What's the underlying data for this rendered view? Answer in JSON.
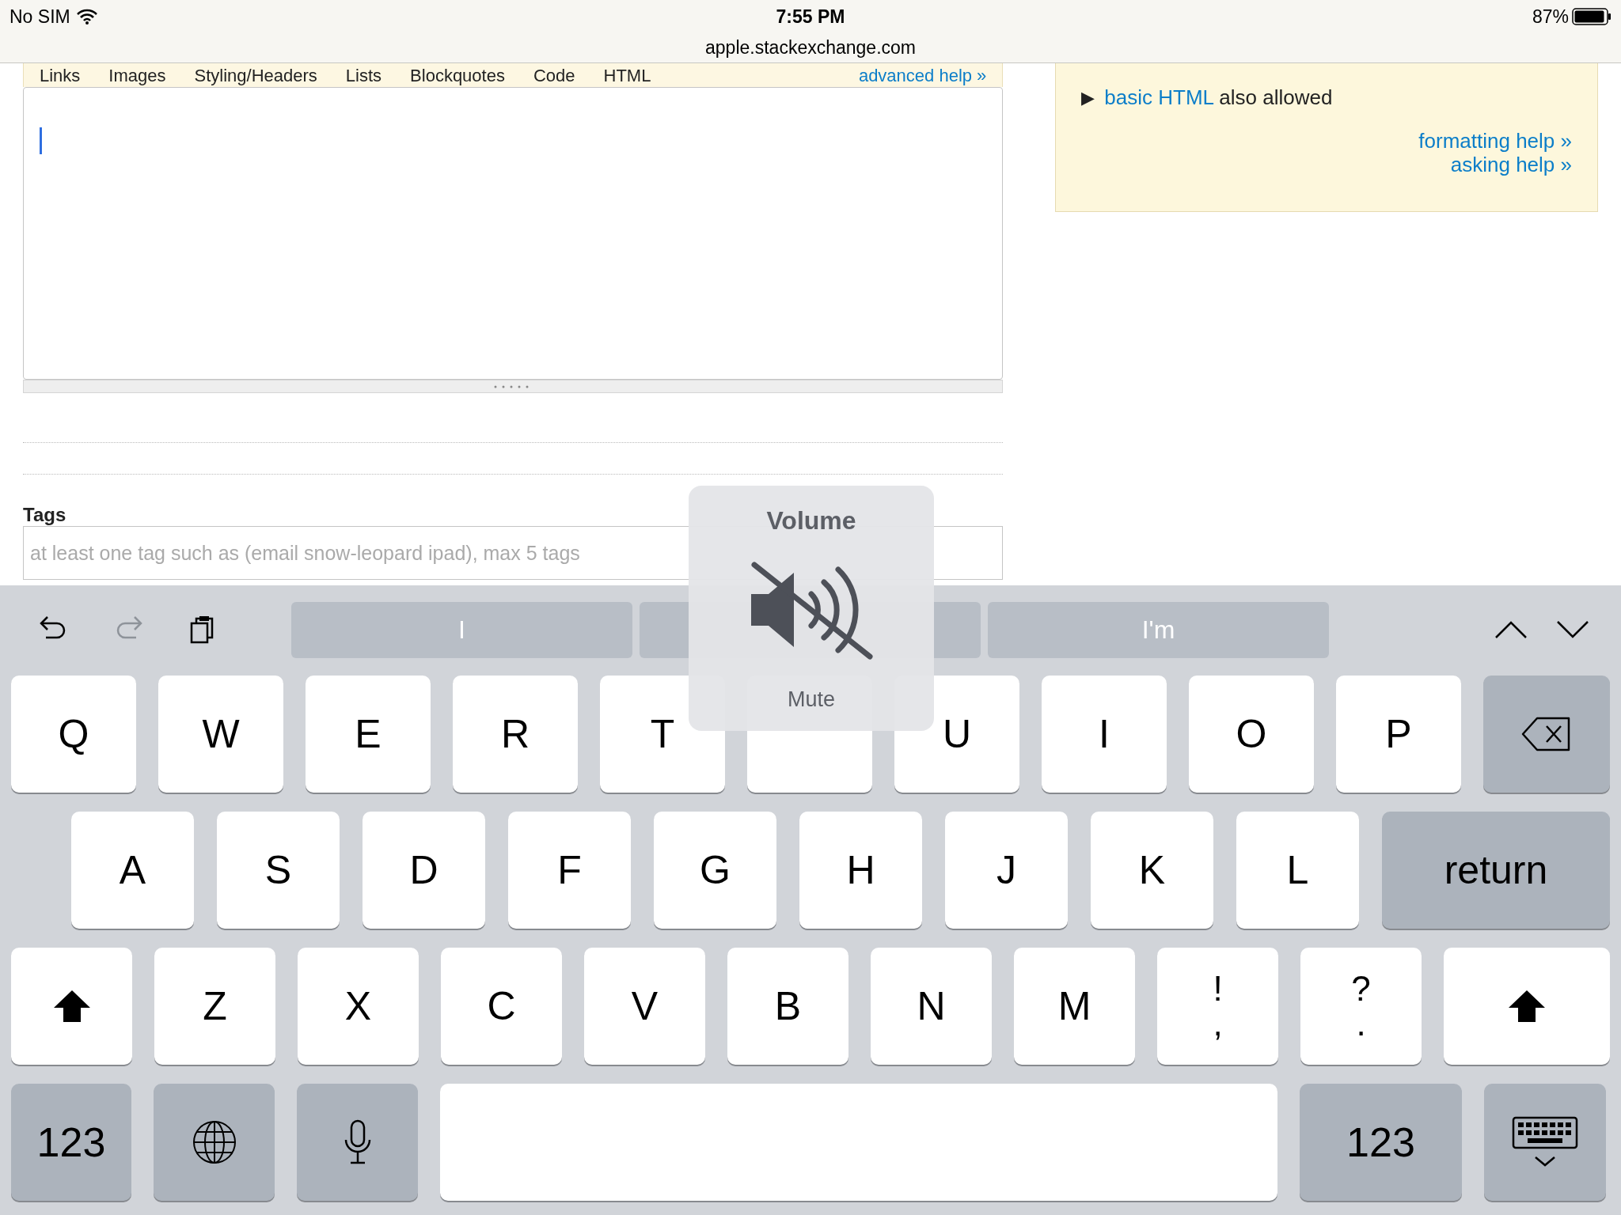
{
  "status_bar": {
    "carrier": "No SIM",
    "time": "7:55 PM",
    "url": "apple.stackexchange.com",
    "battery": "87%"
  },
  "editor": {
    "toolbar": [
      "Links",
      "Images",
      "Styling/Headers",
      "Lists",
      "Blockquotes",
      "Code",
      "HTML"
    ],
    "advanced_help": "advanced help »"
  },
  "help_panel": {
    "bullet": "▶",
    "link": "basic HTML",
    "text": "also allowed",
    "links": [
      "formatting help »",
      "asking help »"
    ]
  },
  "tags": {
    "label": "Tags",
    "placeholder": "at least one tag such as (email snow-leopard ipad), max 5 tags"
  },
  "keyboard": {
    "tools": [
      {
        "kind": "undo",
        "disabled": false
      },
      {
        "kind": "redo",
        "disabled": true
      },
      {
        "kind": "paste",
        "disabled": false
      }
    ],
    "suggestions": [
      {
        "kind": "word",
        "text": "I"
      },
      {
        "kind": "blank"
      },
      {
        "kind": "word",
        "text": "I'm"
      }
    ],
    "rows": [
      {
        "keys": [
          {
            "kind": "letter",
            "label": "Q"
          },
          {
            "kind": "letter",
            "label": "W"
          },
          {
            "kind": "letter",
            "label": "E"
          },
          {
            "kind": "letter",
            "label": "R"
          },
          {
            "kind": "letter",
            "label": "T"
          },
          {
            "kind": "covered"
          },
          {
            "kind": "letter",
            "label": "U"
          },
          {
            "kind": "letter",
            "label": "I"
          },
          {
            "kind": "letter",
            "label": "O"
          },
          {
            "kind": "letter",
            "label": "P"
          },
          {
            "kind": "backspace"
          }
        ]
      },
      {
        "keys": [
          {
            "kind": "letter",
            "label": "A"
          },
          {
            "kind": "letter",
            "label": "S"
          },
          {
            "kind": "letter",
            "label": "D"
          },
          {
            "kind": "letter",
            "label": "F"
          },
          {
            "kind": "letter",
            "label": "G"
          },
          {
            "kind": "letter",
            "label": "H"
          },
          {
            "kind": "letter",
            "label": "J"
          },
          {
            "kind": "letter",
            "label": "K"
          },
          {
            "kind": "letter",
            "label": "L"
          },
          {
            "kind": "return",
            "label": "return"
          }
        ]
      },
      {
        "keys": [
          {
            "kind": "shift"
          },
          {
            "kind": "letter",
            "label": "Z"
          },
          {
            "kind": "letter",
            "label": "X"
          },
          {
            "kind": "letter",
            "label": "C"
          },
          {
            "kind": "letter",
            "label": "V"
          },
          {
            "kind": "letter",
            "label": "B"
          },
          {
            "kind": "letter",
            "label": "N"
          },
          {
            "kind": "letter",
            "label": "M"
          },
          {
            "kind": "dual",
            "top": "!",
            "bottom": ","
          },
          {
            "kind": "dual",
            "top": "?",
            "bottom": "."
          },
          {
            "kind": "shift"
          }
        ]
      },
      {
        "keys": [
          {
            "kind": "numbers",
            "label": "123"
          },
          {
            "kind": "globe"
          },
          {
            "kind": "mic"
          },
          {
            "kind": "space"
          },
          {
            "kind": "numbers",
            "label": "123"
          },
          {
            "kind": "hide"
          }
        ]
      }
    ]
  },
  "volume_hud": {
    "title": "Volume",
    "label": "Mute"
  }
}
